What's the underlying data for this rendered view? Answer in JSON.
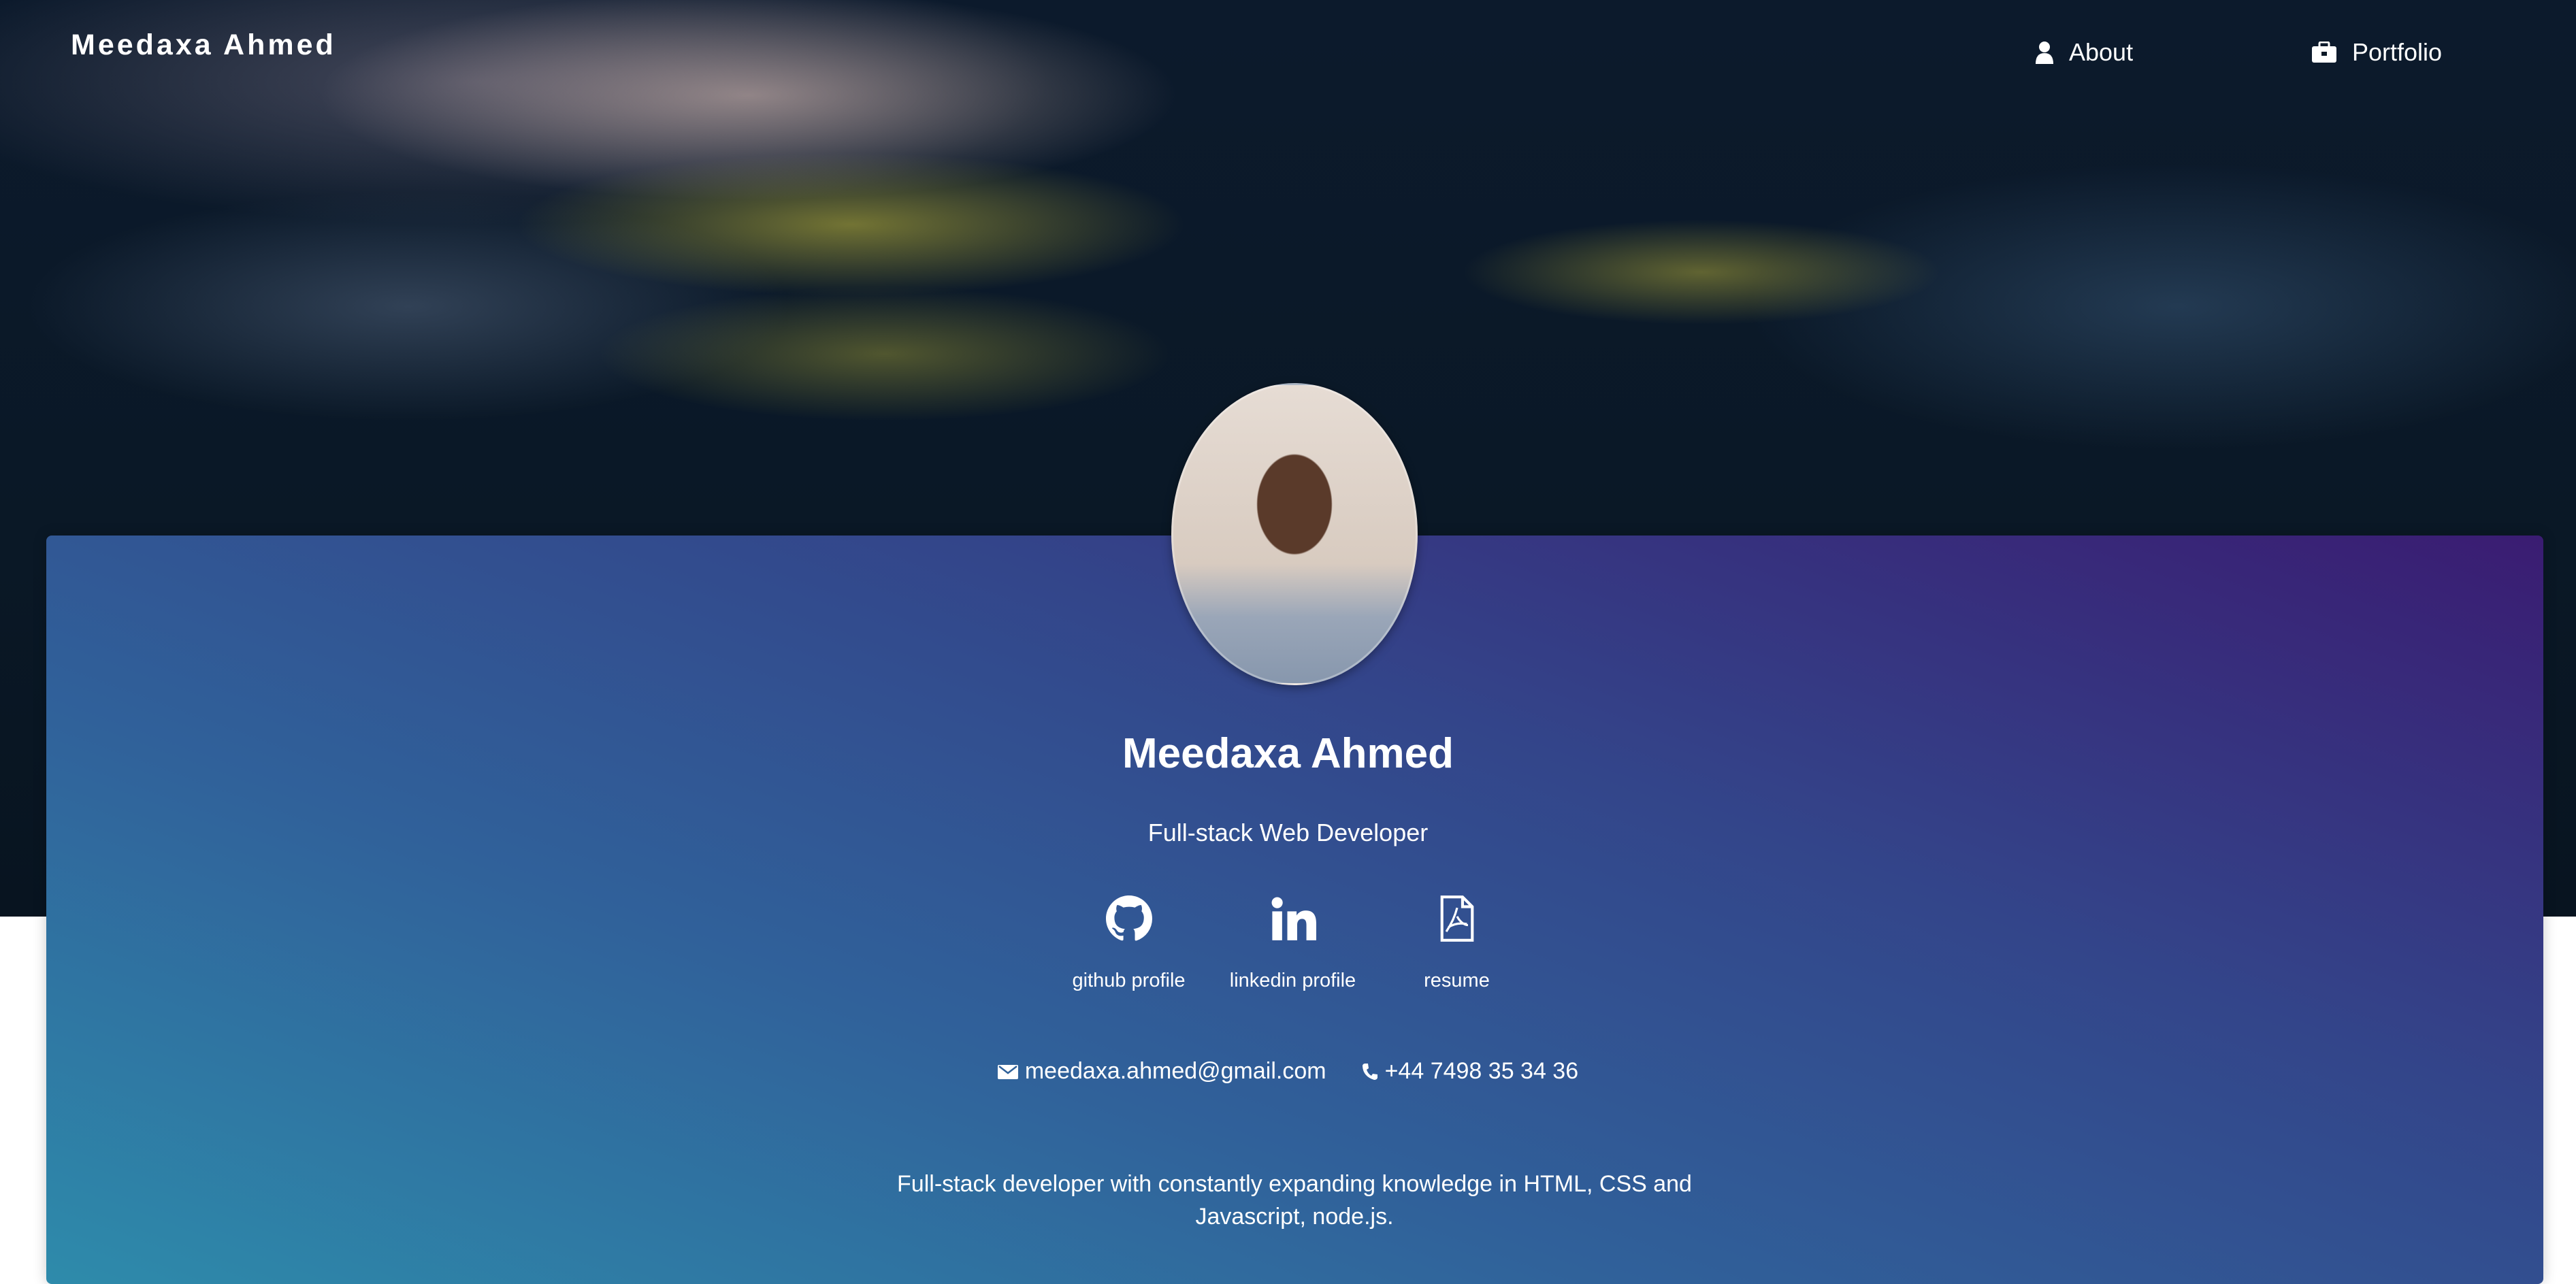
{
  "header": {
    "logo": "Meedaxa Ahmed",
    "nav": [
      {
        "label": "About",
        "icon": "user-icon"
      },
      {
        "label": "Portfolio",
        "icon": "briefcase-icon"
      }
    ]
  },
  "profile": {
    "name": "Meedaxa Ahmed",
    "role": "Full-stack Web Developer",
    "links": [
      {
        "label": "github profile",
        "icon": "github-icon"
      },
      {
        "label": "linkedin profile",
        "icon": "linkedin-icon"
      },
      {
        "label": "resume",
        "icon": "pdf-file-icon"
      }
    ],
    "email": "meedaxa.ahmed@gmail.com",
    "phone": "+44 7498 35 34 36",
    "description": "Full-stack developer with constantly expanding knowledge in HTML, CSS and Javascript, node.js."
  },
  "colors": {
    "card_start": "#2e8bab",
    "card_end": "#3a1c72"
  }
}
